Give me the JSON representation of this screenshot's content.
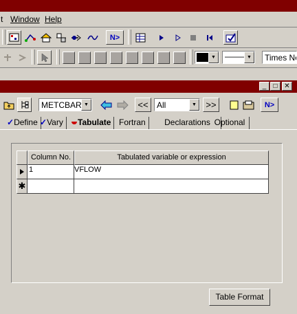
{
  "menubar": {
    "items": [
      "t",
      "Window",
      "Help"
    ]
  },
  "toolbar2": {
    "line_style_label": "———",
    "font_name": "Times New"
  },
  "window": {
    "block_name": "METCBAR",
    "filter_value": "All",
    "nav_prev_label": "<<",
    "nav_next_label": ">>",
    "next_label": "N>"
  },
  "tabs": [
    {
      "label": "Define",
      "marker": "check"
    },
    {
      "label": "Vary",
      "marker": "check"
    },
    {
      "label": "Tabulate",
      "marker": "red-semicircle"
    },
    {
      "label": "Fortran",
      "marker": ""
    },
    {
      "label": "Declarations",
      "marker": ""
    },
    {
      "label": "Optional",
      "marker": ""
    }
  ],
  "table": {
    "columns": [
      "Column No.",
      "Tabulated variable or expression"
    ],
    "rows": [
      {
        "column_no": "1",
        "expression": "VFLOW"
      },
      {
        "column_no": "",
        "expression": ""
      }
    ]
  },
  "buttons": {
    "table_format": "Table Format"
  },
  "colors": {
    "title_bar": "#800000",
    "face": "#d4d0c8",
    "check_blue": "#0000c0",
    "tab_marker_red": "#cc0000"
  }
}
